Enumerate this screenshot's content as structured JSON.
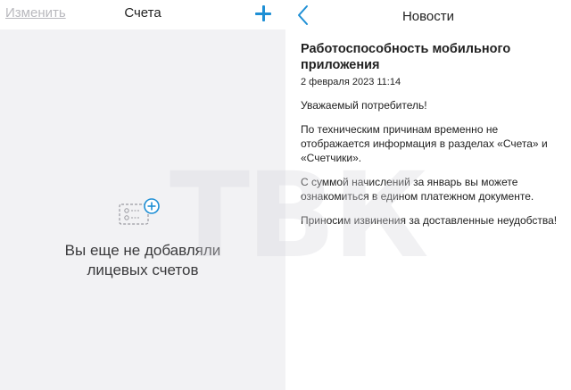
{
  "accounts": {
    "edit_label": "Изменить",
    "title": "Счета",
    "empty_message_line1": "Вы еще не добавляли",
    "empty_message_line2": "лицевых счетов"
  },
  "news": {
    "title": "Новости",
    "article_title": "Работоспособность мобильного приложения",
    "article_date": "2 февраля 2023 11:14",
    "paragraphs": [
      "Уважаемый потребитель!",
      "По техническим причинам временно не отображается информация в разделах «Счета» и «Счетчики».",
      "С суммой начислений за январь вы можете ознакомиться в едином платежном документе.",
      "Приносим извинения за доставленные неудобства!"
    ]
  },
  "watermark": "ТВК",
  "colors": {
    "accent": "#1e8fd5",
    "muted": "#b9b9be",
    "left_bg": "#f2f2f4"
  },
  "icons": {
    "add": "plus-icon",
    "back": "chevron-left-icon",
    "empty_state": "add-card-icon"
  }
}
